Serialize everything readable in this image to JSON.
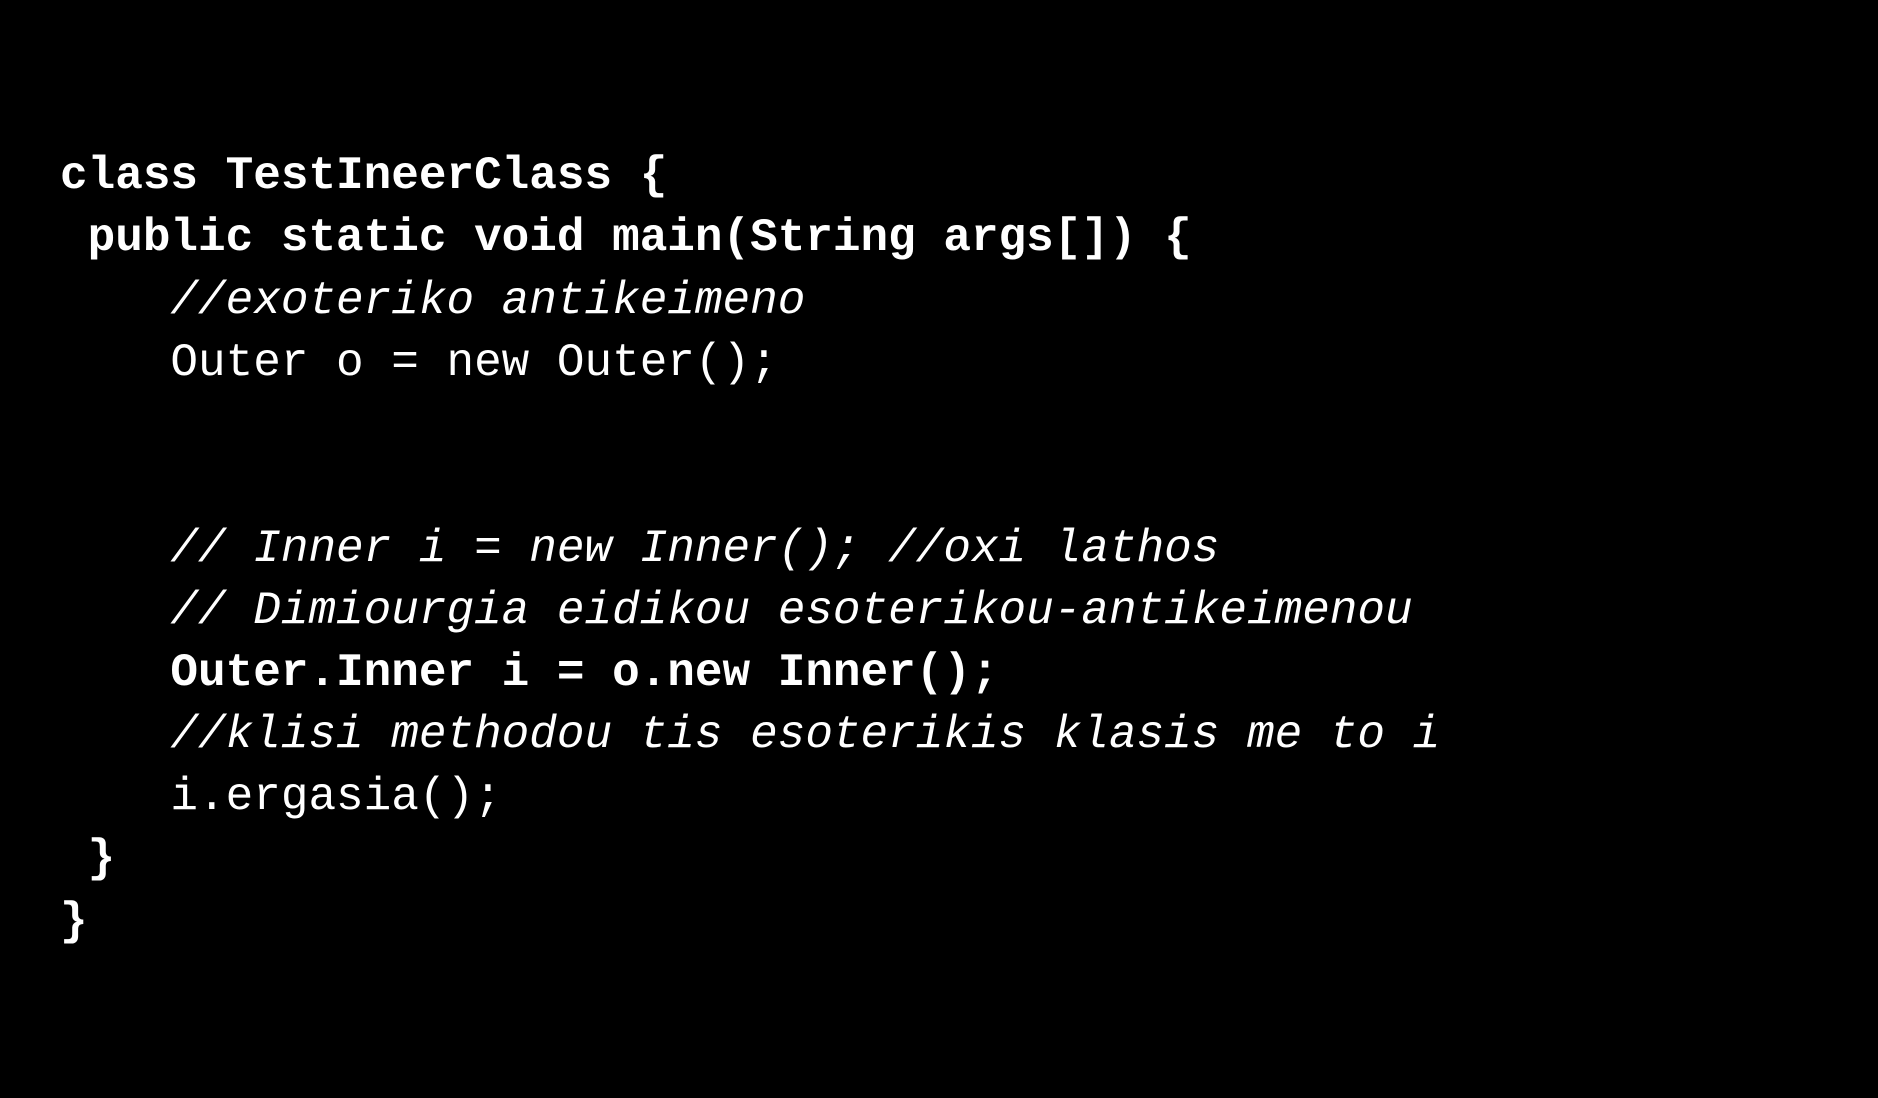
{
  "code": {
    "lines": [
      {
        "id": "line1",
        "text": "class TestIneerClass {",
        "style": "bold"
      },
      {
        "id": "line2",
        "text": " public static void main(String args[]) {",
        "style": "bold"
      },
      {
        "id": "line3",
        "text": "    //exoteriko antikeimeno",
        "style": "italic"
      },
      {
        "id": "line4",
        "text": "    Outer o = new Outer();",
        "style": "normal"
      },
      {
        "id": "line5",
        "text": "",
        "style": "empty"
      },
      {
        "id": "line6",
        "text": "",
        "style": "empty"
      },
      {
        "id": "line7",
        "text": "    // Inner i = new Inner(); //oxi lathos",
        "style": "italic"
      },
      {
        "id": "line8",
        "text": "    // Dimiourgia eidikou esoterikou-antikeimenou",
        "style": "italic"
      },
      {
        "id": "line9",
        "text": "    Outer.Inner i = o.new Inner();",
        "style": "bold"
      },
      {
        "id": "line10",
        "text": "    //klisi methodou tis esoterikis klasis me to i",
        "style": "italic"
      },
      {
        "id": "line11",
        "text": "    i.ergasia();",
        "style": "normal"
      },
      {
        "id": "line12",
        "text": " }",
        "style": "bold"
      },
      {
        "id": "line13",
        "text": "}",
        "style": "bold"
      }
    ]
  }
}
